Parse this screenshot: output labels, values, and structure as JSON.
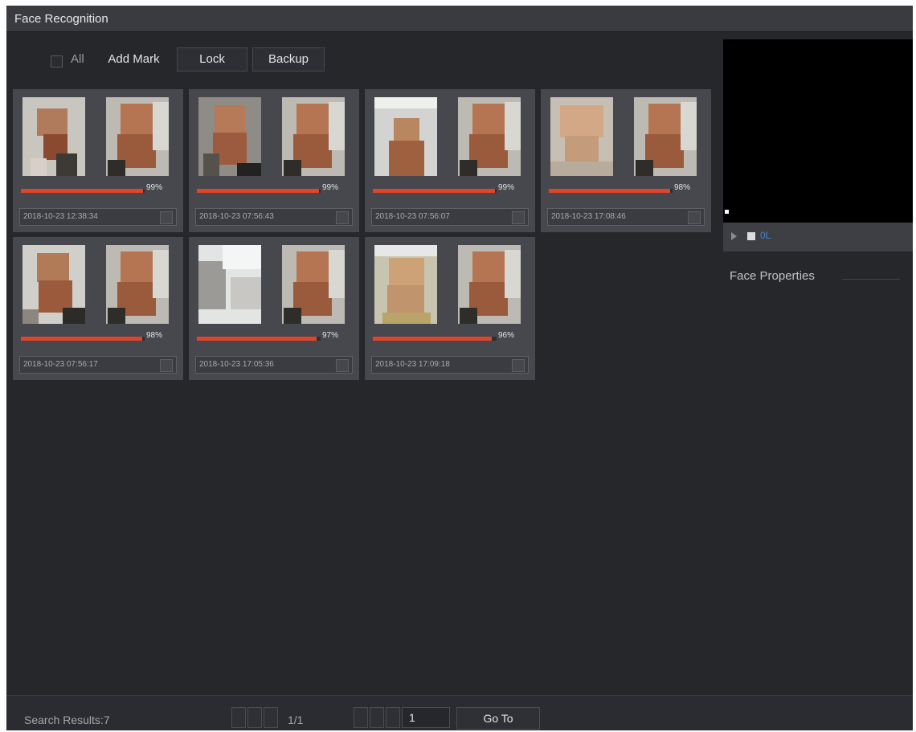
{
  "window": {
    "title": "Face Recognition"
  },
  "toolbar": {
    "all_label": "All",
    "add_mark_label": "Add Mark",
    "lock_label": "Lock",
    "backup_label": "Backup"
  },
  "results": [
    {
      "similarity": 0.99,
      "similarity_text": "99%",
      "timestamp": "2018-10-23 12:38:34"
    },
    {
      "similarity": 0.99,
      "similarity_text": "99%",
      "timestamp": "2018-10-23 07:56:43"
    },
    {
      "similarity": 0.99,
      "similarity_text": "99%",
      "timestamp": "2018-10-23 07:56:07"
    },
    {
      "similarity": 0.98,
      "similarity_text": "98%",
      "timestamp": "2018-10-23 17:08:46"
    },
    {
      "similarity": 0.98,
      "similarity_text": "98%",
      "timestamp": "2018-10-23 07:56:17"
    },
    {
      "similarity": 0.97,
      "similarity_text": "97%",
      "timestamp": "2018-10-23 17:05:36"
    },
    {
      "similarity": 0.96,
      "similarity_text": "96%",
      "timestamp": "2018-10-23 17:09:18"
    }
  ],
  "preview": {
    "control_text": "0L"
  },
  "face_properties": {
    "title": "Face Properties"
  },
  "footer": {
    "search_results": "Search Results:7",
    "page_info": "1/1",
    "page_input_value": "1",
    "goto_label": "Go To"
  },
  "colors": {
    "bar": "#e0442a",
    "card": "#47484e",
    "background": "#26272b"
  }
}
